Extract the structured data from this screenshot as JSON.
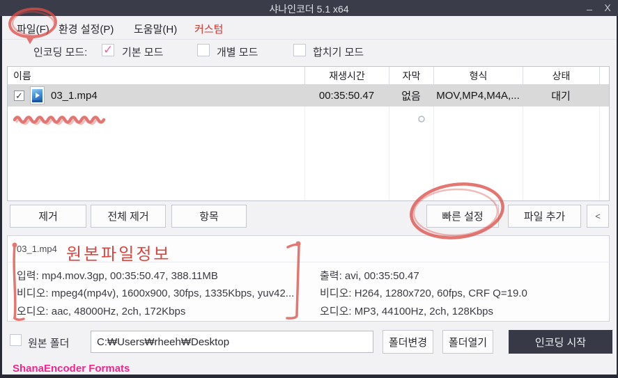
{
  "window": {
    "title": "샤나인코더  5.1 x64",
    "minimize_label": "_",
    "close_label": "X"
  },
  "menu_bar": {
    "items": [
      {
        "label": "파일(F)"
      },
      {
        "label": "환경 설정(P)"
      },
      {
        "label": "도움말(H)"
      },
      {
        "label": "커스텀"
      }
    ]
  },
  "mode_bar": {
    "label": "인코딩 모드:",
    "options": [
      {
        "label": "기본 모드",
        "checked": true
      },
      {
        "label": "개별 모드",
        "checked": false
      },
      {
        "label": "합치기 모드",
        "checked": false
      }
    ]
  },
  "file_table": {
    "headers": [
      "이름",
      "재생시간",
      "자막",
      "형식",
      "상태"
    ],
    "row": {
      "checked": true,
      "name": "03_1.mp4",
      "duration": "00:35:50.47",
      "subtitle": "없음",
      "format": "MOV,MP4,M4A,...",
      "status": "대기"
    }
  },
  "toolbar": {
    "remove": "제거",
    "remove_all": "전체 제거",
    "item": "항목",
    "quick_settings": "빠른 설정",
    "add_file": "파일 추가",
    "collapse": "<"
  },
  "info_panel": {
    "filename": "03_1.mp4",
    "input_line": "입력: mp4.mov.3gp, 00:35:50.47, 388.11MB",
    "input_video_line": "비디오: mpeg4(mp4v), 1600x900, 30fps, 1335Kbps,  yuv42...",
    "input_audio_line": "오디오: aac, 48000Hz, 2ch, 172Kbps",
    "output_line": "출력: avi, 00:35:50.47",
    "output_video_line": "비디오: H264, 1280x720, 60fps, CRF Q=19.0",
    "output_audio_line": "오디오: MP3, 44100Hz, 2ch, 128Kbps"
  },
  "bottom_bar": {
    "source_folder_label": "원본 폴더",
    "source_folder_checked": false,
    "path_value": "C:₩Users₩rheeh₩Desktop",
    "change_folder": "폴더변경",
    "open_folder": "폴더열기",
    "start_encoding": "인코딩 시작"
  },
  "status_bar": {
    "text": "ShanaEncoder Formats"
  },
  "annotations": {
    "note_label": "원본파일정보",
    "annotation_color": "#dc4f4a"
  },
  "colors": {
    "titlebar": "#3a3d49",
    "accent_pink_check": "#ee5fa4",
    "menu_red": "#d9332e",
    "status_pink": "#f2248e",
    "selected_row": "#d9d9d9",
    "start_button": "#373a46"
  }
}
